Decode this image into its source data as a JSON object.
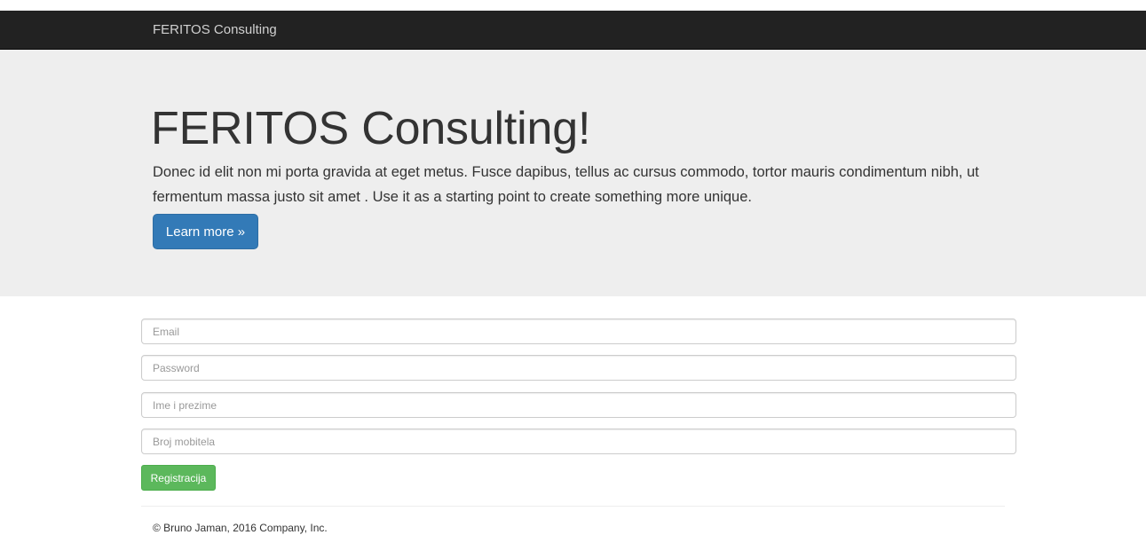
{
  "navbar": {
    "brand": "FERITOS Consulting"
  },
  "jumbotron": {
    "heading": "FERITOS Consulting!",
    "paragraph": "Donec id elit non mi porta gravida at eget metus. Fusce dapibus, tellus ac cursus commodo, tortor mauris condimentum nibh, ut fermentum massa justo sit amet . Use it as a starting point to create something more unique.",
    "button_label": "Learn more »"
  },
  "form": {
    "email": {
      "placeholder": "Email",
      "value": ""
    },
    "password": {
      "placeholder": "Password",
      "value": ""
    },
    "name": {
      "placeholder": "Ime i prezime",
      "value": ""
    },
    "mobile": {
      "placeholder": "Broj mobitela",
      "value": ""
    },
    "submit_label": "Registracija"
  },
  "footer": {
    "text": "© Bruno Jaman, 2016 Company, Inc."
  },
  "colors": {
    "navbar_bg": "#222222",
    "jumbotron_bg": "#eeeeee",
    "primary": "#337ab7",
    "success": "#5cb85c"
  }
}
